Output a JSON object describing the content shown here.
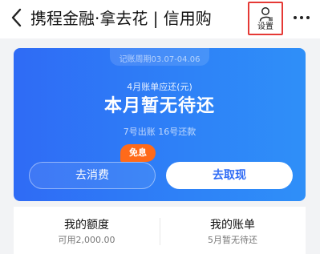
{
  "header": {
    "title": "携程金融·拿去花 | 信用购",
    "settings_label": "设置"
  },
  "card": {
    "period": "记账周期03.07-04.06",
    "bill_label": "4月账单应还(元)",
    "bill_status": "本月暂无待还",
    "dates": "7号出账 16号还款",
    "consume_button": "去消费",
    "free_badge": "免息",
    "withdraw_button": "去取现"
  },
  "summary": {
    "quota_title": "我的额度",
    "quota_value": "可用2,000.00",
    "bill_title": "我的账单",
    "bill_value": "5月暂无待还"
  },
  "colors": {
    "card_blue": "#2f6bf5",
    "badge_orange": "#ff6a1a",
    "highlight_red": "#e53935"
  },
  "icons": {
    "back": "chevron-left-icon",
    "settings": "user-settings-icon",
    "more": "more-dots-icon"
  }
}
